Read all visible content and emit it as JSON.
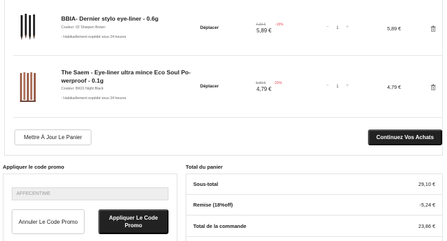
{
  "cart": {
    "items": [
      {
        "name_line1": "BBIA- Dernier stylo eye-liner - 0.6g",
        "name_line2": "",
        "color": "Couleur: 02 Sharpen Brown",
        "delivery": "- Habituellement expédié sous 24 heures",
        "move_label": "Déplacer",
        "old_price": "7,29 €",
        "discount": "-19%",
        "price": "5,89 €",
        "minus": "−",
        "qty": "1",
        "plus": "+",
        "total": "5,89 €",
        "delete_icon": "trash-icon"
      },
      {
        "name_line1": "The Saem - Eye-liner ultra mince Eco Soul Po-",
        "name_line2": "werproof - 0.1g",
        "color": "Couleur: BK01 Night Black",
        "delivery": "- Habituellement expédié sous 24 heures",
        "move_label": "Déplacer",
        "old_price": "5,99 €",
        "discount": "-20%",
        "price": "4,79 €",
        "minus": "−",
        "qty": "1",
        "plus": "+",
        "total": "4,79 €",
        "delete_icon": "trash-icon"
      }
    ],
    "update_label": "Mettre À Jour Le Panier",
    "continue_label": "Continuez Vos Achats"
  },
  "promo": {
    "title": "Appliquer le code promo",
    "code_value": "AFFECENTIME",
    "cancel_label": "Annuler Le Code Promo",
    "apply_label": "Appliquer Le Code Promo"
  },
  "totals": {
    "title": "Total du panier",
    "rows": [
      {
        "label": "Sous-total",
        "value": "29,10 €"
      },
      {
        "label": "Remise (18%off)",
        "value": "-5,24 €"
      },
      {
        "label": "Total de la commande",
        "value": "23,86 €"
      }
    ]
  },
  "colors": {
    "accent_dark": "#222222",
    "discount_red": "#e24b5b",
    "border": "#e3e3e3"
  }
}
